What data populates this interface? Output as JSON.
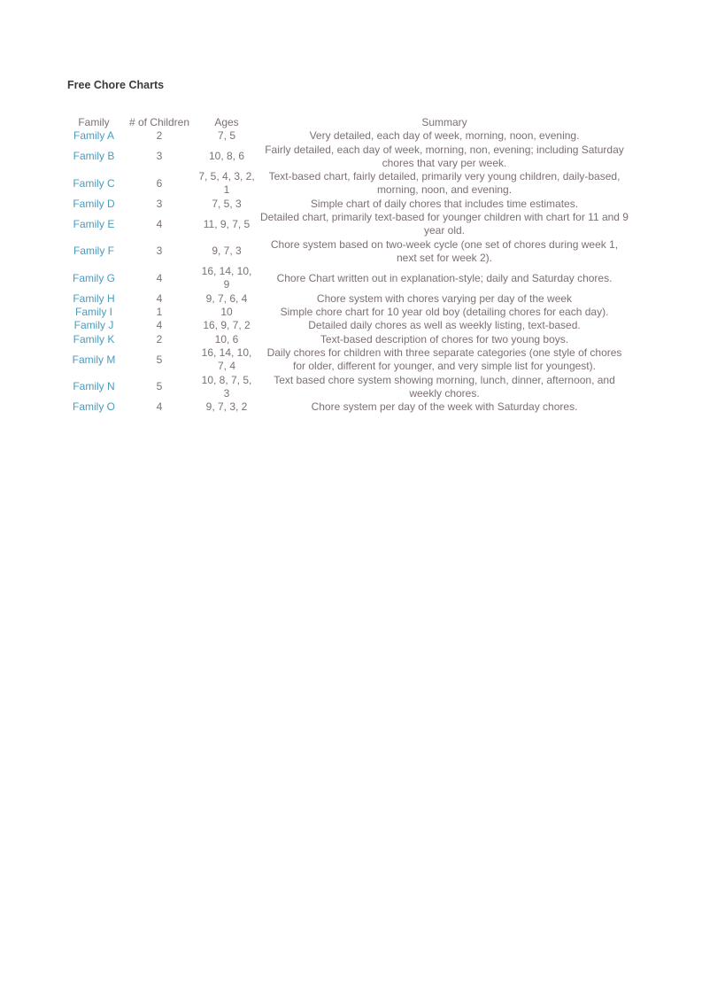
{
  "document": {
    "title": "Free Chore Charts"
  },
  "table": {
    "headers": {
      "family": "Family",
      "children": "# of Children",
      "ages": "Ages",
      "summary": "Summary"
    },
    "rows": [
      {
        "family": "Family A",
        "children": "2",
        "ages": "7, 5",
        "summary": "Very detailed, each day of week, morning, noon, evening.",
        "lines": 1
      },
      {
        "family": "Family B",
        "children": "3",
        "ages": "10, 8, 6",
        "summary": "Fairly detailed, each day of week, morning, non, evening; including Saturday chores that vary per week.",
        "lines": 2
      },
      {
        "family": "Family C",
        "children": "6",
        "ages": "7, 5, 4, 3, 2, 1",
        "summary": "Text-based chart, fairly detailed, primarily very young children, daily-based, morning, noon, and evening.",
        "lines": 2
      },
      {
        "family": "Family D",
        "children": "3",
        "ages": "7, 5, 3",
        "summary": "Simple chart of daily chores that includes time estimates.",
        "lines": 1
      },
      {
        "family": "Family E",
        "children": "4",
        "ages": "11, 9, 7, 5",
        "summary": "Detailed chart, primarily text-based for younger children with chart for 11 and 9 year old.",
        "lines": 2
      },
      {
        "family": "Family F",
        "children": "3",
        "ages": "9, 7, 3",
        "summary": "Chore system based on two-week cycle (one set of chores during week 1, next set for week 2).",
        "lines": 2
      },
      {
        "family": "Family G",
        "children": "4",
        "ages": "16, 14, 10, 9",
        "summary": "Chore Chart written out in explanation-style; daily and Saturday chores.",
        "lines": 2
      },
      {
        "family": "Family H",
        "children": "4",
        "ages": "9, 7, 6, 4",
        "summary": "Chore system with chores varying per day of the week",
        "lines": 1
      },
      {
        "family": "Family I",
        "children": "1",
        "ages": "10",
        "summary": "Simple chore chart for 10 year old boy (detailing chores for each day).",
        "lines": 1
      },
      {
        "family": "Family J",
        "children": "4",
        "ages": "16, 9, 7, 2",
        "summary": "Detailed daily chores as well as weekly listing, text-based.",
        "lines": 1
      },
      {
        "family": "Family K",
        "children": "2",
        "ages": "10, 6",
        "summary": "Text-based description of chores for two young boys.",
        "lines": 1
      },
      {
        "family": "Family M",
        "children": "5",
        "ages": "16, 14, 10, 7, 4",
        "summary": "Daily chores for children with three separate categories (one style of chores for older, different for younger, and very simple list for youngest).",
        "lines": 2
      },
      {
        "family": "Family N",
        "children": "5",
        "ages": "10, 8, 7, 5, 3",
        "summary": "Text based chore system showing morning, lunch, dinner, afternoon, and weekly chores.",
        "lines": 2
      },
      {
        "family": "Family O",
        "children": "4",
        "ages": "9, 7, 3, 2",
        "summary": "Chore system per day of the week with Saturday chores.",
        "lines": 1
      }
    ]
  },
  "colors": {
    "link": "#4a9bbd",
    "text": "#7d7070",
    "title": "#3a3a3a"
  }
}
